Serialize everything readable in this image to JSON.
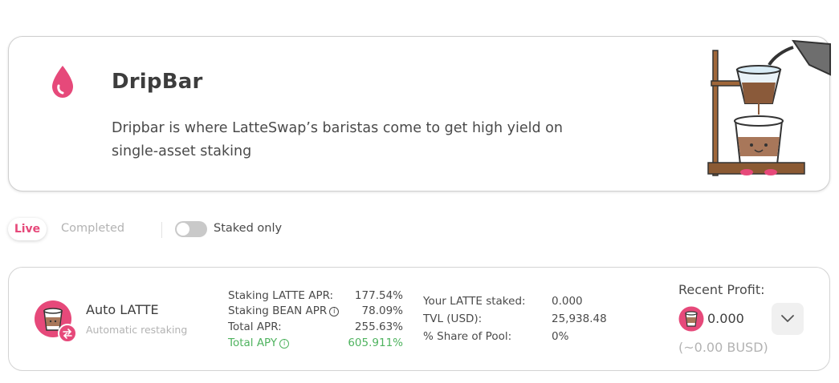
{
  "hero": {
    "title": "DripBar",
    "description": "Dripbar is where LatteSwap’s baristas come to get high yield on single-asset staking"
  },
  "filters": {
    "live_tab": "Live",
    "completed_tab": "Completed",
    "staked_only_label": "Staked only",
    "staked_only_enabled": false
  },
  "pool": {
    "name": "Auto LATTE",
    "subtitle": "Automatic restaking",
    "apr": [
      {
        "label": "Staking LATTE APR:",
        "value": "177.54%",
        "info": false,
        "highlight": false
      },
      {
        "label": "Staking BEAN APR",
        "value": "78.09%",
        "info": true,
        "highlight": false
      },
      {
        "label": "Total APR:",
        "value": "255.63%",
        "info": false,
        "highlight": false
      },
      {
        "label": "Total APY",
        "value": "605.911%",
        "info": true,
        "highlight": true
      }
    ],
    "stats": [
      {
        "label": "Your LATTE staked:",
        "value": "0.000"
      },
      {
        "label": "TVL (USD):",
        "value": "25,938.48"
      },
      {
        "label": "% Share of Pool:",
        "value": "0%"
      }
    ],
    "recent_profit": {
      "label": "Recent Profit:",
      "value": "0.000",
      "usd": "(~0.00 BUSD)"
    }
  },
  "colors": {
    "accent": "#e6497a",
    "green": "#4fb35f",
    "muted": "#b3b3b3"
  },
  "icons": {
    "hero": "drop-icon",
    "pool": "latte-cup-icon",
    "expand": "chevron-down-icon",
    "info": "info-icon"
  }
}
